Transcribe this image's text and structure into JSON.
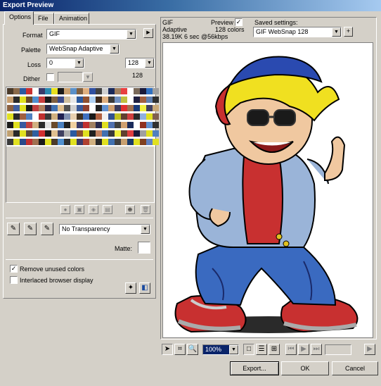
{
  "window": {
    "title": "Export Preview"
  },
  "tabs": [
    {
      "label": "Options",
      "active": true
    },
    {
      "label": "File",
      "active": false
    },
    {
      "label": "Animation",
      "active": false
    }
  ],
  "options": {
    "format_label": "Format",
    "format_value": "GIF",
    "palette_label": "Palette",
    "palette_value": "WebSnap Adaptive",
    "loss_label": "Loss",
    "loss_value": "0",
    "colors_value": "128",
    "colors_count": "128",
    "dither_label": "Dither",
    "transparency_value": "No Transparency",
    "matte_label": "Matte:",
    "remove_unused_label": "Remove unused colors",
    "remove_unused_checked": true,
    "interlaced_label": "Interlaced browser display",
    "interlaced_checked": false
  },
  "preview": {
    "format": "GIF",
    "palette": "Adaptive",
    "stats": "38.19K  6 sec @56kbps",
    "preview_label": "Preview",
    "preview_checked": true,
    "colors_text": "128 colors",
    "saved_settings_label": "Saved settings:",
    "saved_settings_value": "GIF WebSnap 128"
  },
  "toolbar": {
    "zoom_value": "100%"
  },
  "buttons": {
    "export": "Export...",
    "ok": "OK",
    "cancel": "Cancel"
  },
  "swatches": [
    "#4a3a2a",
    "#8a6a4a",
    "#2a5aa0",
    "#c83030",
    "#fff",
    "#3a3a6a",
    "#2a8ab0",
    "#e8e020",
    "#1a1a1a",
    "#c8a070",
    "#5a90c8",
    "#806040",
    "#e0b080",
    "#3050a0",
    "#404040",
    "#d0d0d0",
    "#1a2a5a",
    "#a08060",
    "#e84040",
    "#fff",
    "#7a6a5a",
    "#1a1a3a",
    "#3070c0",
    "#a0a0a0",
    "#c8a070",
    "#2a2a2a",
    "#e0e020",
    "#6a4a2a",
    "#5090d0",
    "#c84040",
    "#1a1a1a",
    "#806040",
    "#3a4a8a",
    "#d0c0a0",
    "#e8e8e8",
    "#2a5aa0",
    "#905030",
    "#b0d0f0",
    "#402a1a",
    "#e0b080",
    "#3a3a3a",
    "#7090c0",
    "#c0c040",
    "#fff",
    "#202040",
    "#a06040",
    "#6080b0",
    "#303030",
    "#8a6040",
    "#4060a0",
    "#e0e020",
    "#1a1a1a",
    "#c04040",
    "#b08060",
    "#2a2a4a",
    "#4070b0",
    "#e0c090",
    "#505050",
    "#d0d0d0",
    "#3a5a9a",
    "#904030",
    "#fff",
    "#202020",
    "#6090d0",
    "#d0a070",
    "#3a3a5a",
    "#e03030",
    "#a07050",
    "#1a3a7a",
    "#f0f040",
    "#404060",
    "#c8a878",
    "#e0e020",
    "#2a2a2a",
    "#a06040",
    "#5080c0",
    "#fff",
    "#c03030",
    "#3a3a3a",
    "#d0b080",
    "#202050",
    "#8090b0",
    "#e8d0b0",
    "#403020",
    "#4070c0",
    "#1a1a1a",
    "#b06040",
    "#f0f0f0",
    "#305090",
    "#c0c020",
    "#604030",
    "#d04040",
    "#2a2a2a",
    "#90b0e0",
    "#e0e020",
    "#806050",
    "#1a1a1a",
    "#e0e020",
    "#3a5aa0",
    "#c04040",
    "#d0b080",
    "#2a2a2a",
    "#e0e0e0",
    "#6a4a2a",
    "#4a80c0",
    "#202020",
    "#f0d0a0",
    "#3a3a6a",
    "#c03030",
    "#a08060",
    "#2a2a4a",
    "#e0e020",
    "#5070b0",
    "#404040",
    "#d0a070",
    "#1a2a5a",
    "#fff",
    "#903020",
    "#6090d0",
    "#303030",
    "#c0a070",
    "#2a2a2a",
    "#e0e020",
    "#5a4a3a",
    "#3060a0",
    "#d03030",
    "#1a1a1a",
    "#e0c090",
    "#404060",
    "#b0b0b0",
    "#2a5aa0",
    "#8a5030",
    "#e0e020",
    "#202020",
    "#c08060",
    "#4070b0",
    "#3a3a3a",
    "#f0f040",
    "#604030",
    "#e04040",
    "#1a1a3a",
    "#a0a0a0",
    "#e0e020",
    "#5080c0",
    "#3a3a3a",
    "#e0e020",
    "#2a4a8a",
    "#c03030",
    "#a07050",
    "#1a1a1a",
    "#e0e020",
    "#4a3a2a",
    "#5090d0",
    "#303030",
    "#e0e020",
    "#3a3a6a",
    "#b04030",
    "#d0b080",
    "#2a2a2a",
    "#e0e020",
    "#4070b0",
    "#404040",
    "#c8a070",
    "#1a3a6a",
    "#e0e020",
    "#804020",
    "#6080c0",
    "#e0e020"
  ]
}
